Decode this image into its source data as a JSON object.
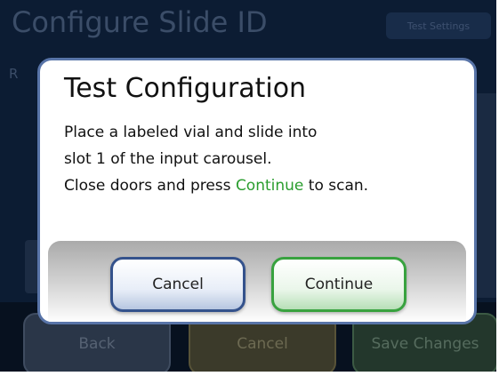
{
  "screen": {
    "title": "Configure Slide ID",
    "test_settings_label": "Test Settings",
    "background_fragment": "R"
  },
  "bottom_bar": {
    "back_label": "Back",
    "cancel_label": "Cancel",
    "save_label": "Save Changes"
  },
  "dialog": {
    "title": "Test Configuration",
    "line1": "Place a labeled vial and slide into",
    "line2": "slot 1 of the input carousel.",
    "line3_prefix": "Close doors and press ",
    "line3_highlight": "Continue",
    "line3_suffix": " to scan.",
    "cancel_label": "Cancel",
    "continue_label": "Continue"
  },
  "colors": {
    "screen_bg": "#0c1c33",
    "dialog_border": "#5874a8",
    "highlight_green": "#2a9d2e",
    "cancel_border": "#34528c",
    "continue_border": "#38a23f"
  }
}
